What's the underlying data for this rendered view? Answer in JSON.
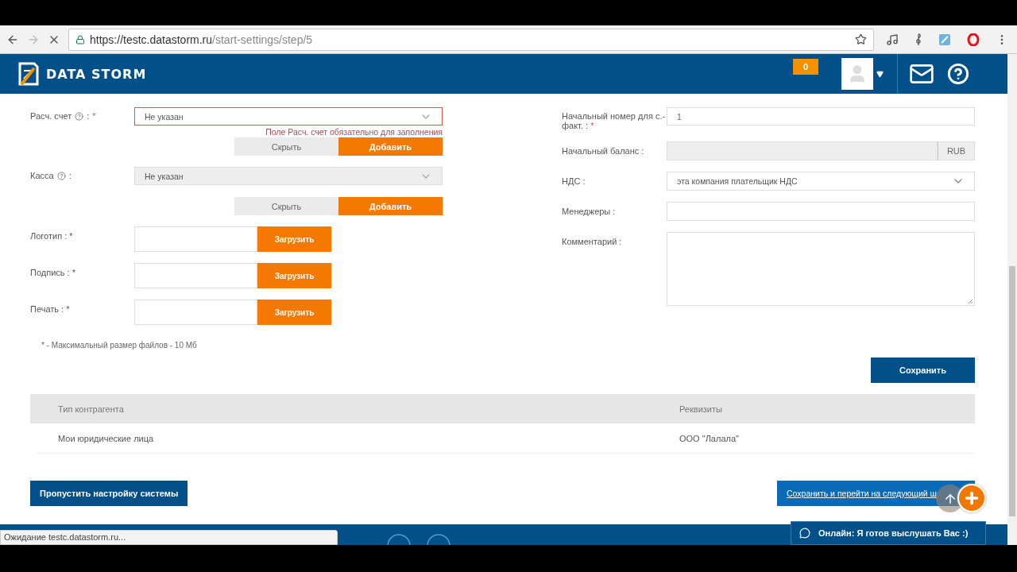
{
  "browser": {
    "url_host": "https://testc.datastorm.ru",
    "url_path": "/start-settings/step/5",
    "loading": true
  },
  "header": {
    "logo": "DATA STORM",
    "notification_count": "0"
  },
  "left_fields": [
    {
      "kind": "select",
      "label": "Расч. счет",
      "help": true,
      "suffix": ":",
      "required_mark": "*",
      "value": "Не указан",
      "error": true,
      "error_text": "Поле Расч. счет обязательно для заполнения",
      "disabled": false,
      "actions": [
        "Скрыть",
        "Добавить"
      ]
    },
    {
      "kind": "select",
      "label": "Касса",
      "help": true,
      "suffix": ":",
      "value": "Не указан",
      "error": false,
      "disabled": true,
      "actions": [
        "Скрыть",
        "Добавить"
      ]
    },
    {
      "kind": "upload",
      "label": "Логотип : *",
      "button": "Загрузить"
    },
    {
      "kind": "upload",
      "label": "Подпись : *",
      "button": "Загрузить"
    },
    {
      "kind": "upload",
      "label": "Печать : *",
      "button": "Загрузить"
    }
  ],
  "file_note": "* - Максимальный размер файлов - 10 Мб",
  "right_fields": [
    {
      "kind": "text",
      "label": "Начальный номер для с.-факт. :",
      "required_mark": "*",
      "value": "1",
      "disabled": false
    },
    {
      "kind": "addon",
      "label": "Начальный баланс :",
      "addon": "RUB",
      "disabled": true
    },
    {
      "kind": "select",
      "label": "НДС :",
      "value": "эта компания плательщик НДС",
      "disabled": false
    },
    {
      "kind": "text",
      "label": "Менеджеры :",
      "disabled": false
    },
    {
      "kind": "textarea",
      "label": "Комментарий :",
      "disabled": false
    }
  ],
  "save_button": "Сохранить",
  "table": {
    "columns": [
      "Тип контрагента",
      "Реквизиты"
    ],
    "rows": [
      [
        "Мои юридические лица",
        "ООО \"Лалала\""
      ]
    ]
  },
  "skip_button": "Пропустить настройку системы",
  "next_button": "Сохранить и перейти на следующий ш",
  "chat": "Онлайн: Я готов выслушать Вас :)",
  "status_bar": "Ожидание testc.datastorm.ru..."
}
